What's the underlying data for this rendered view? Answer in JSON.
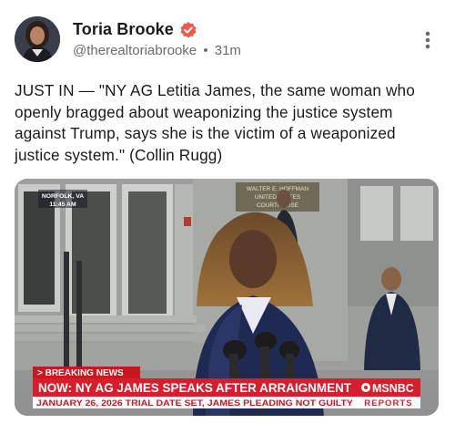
{
  "post": {
    "author_name": "Toria Brooke",
    "handle": "@therealtoriabrooke",
    "separator": "•",
    "timestamp": "31m",
    "text": "JUST IN — \"NY AG Letitia James, the same woman who openly bragged about weaponizing the justice system against Trump, says she is the victim of a weaponized justice system.\" (Collin Rugg)",
    "icons": {
      "verified": "verified-badge-icon",
      "more": "more-vertical-icon"
    },
    "accent_color": "#f0584e"
  },
  "video": {
    "location": "NORFOLK, VA",
    "time": "11:45 AM",
    "building_sign_line1": "WALTER E. HOFFMAN",
    "building_sign_line2": "UNITED STATES",
    "building_sign_line3": "COURTHOUSE",
    "breaking_label": "> BREAKING NEWS",
    "headline": "NOW: NY AG JAMES SPEAKS AFTER ARRAIGNMENT",
    "ticker": "JANUARY 26, 2026 TRIAL DATE SET, JAMES PLEADING NOT GUILTY",
    "network": "MSNBC",
    "network_sub": "REPORTS",
    "colors": {
      "banner_red": "#d81e2c",
      "ticker_bg": "#ffffff",
      "breaking_bg": "#c9161f"
    }
  }
}
